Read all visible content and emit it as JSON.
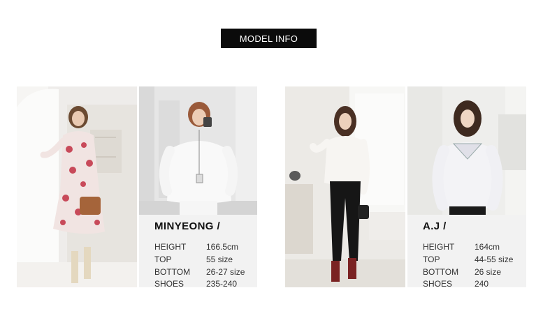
{
  "header": {
    "title": "MODEL INFO"
  },
  "models": [
    {
      "name": "MINYEONG /",
      "specs": [
        {
          "label": "HEIGHT",
          "value": "166.5cm"
        },
        {
          "label": "TOP",
          "value": "55 size"
        },
        {
          "label": "BOTTOM",
          "value": "26-27 size"
        },
        {
          "label": "SHOES",
          "value": "235-240"
        }
      ]
    },
    {
      "name": "A.J /",
      "specs": [
        {
          "label": "HEIGHT",
          "value": "164cm"
        },
        {
          "label": "TOP",
          "value": "44-55 size"
        },
        {
          "label": "BOTTOM",
          "value": "26 size"
        },
        {
          "label": "SHOES",
          "value": "240"
        }
      ]
    }
  ],
  "colors": {
    "banner_bg": "#0b0b0b",
    "info_bg": "#f2f2f2"
  }
}
